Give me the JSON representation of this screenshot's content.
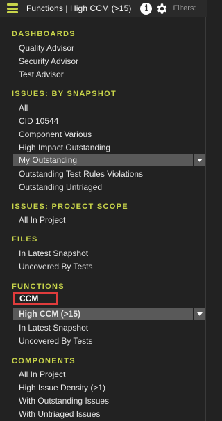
{
  "topbar": {
    "title": "Functions | High CCM (>15)",
    "filters_label": "Filters:",
    "menu_icon": "hamburger-icon",
    "info_icon": "info-icon",
    "settings_icon": "gear-icon",
    "accent_color": "#c8d44a"
  },
  "sections": {
    "dashboards": {
      "title": "DASHBOARDS",
      "items": [
        "Quality Advisor",
        "Security Advisor",
        "Test Advisor"
      ]
    },
    "issues_snapshot": {
      "title": "ISSUES: BY SNAPSHOT",
      "items": [
        "All",
        "CID 10544",
        "Component Various",
        "High Impact Outstanding",
        "My Outstanding",
        "Outstanding Test Rules Violations",
        "Outstanding Untriaged"
      ]
    },
    "issues_project": {
      "title": "ISSUES: PROJECT SCOPE",
      "items": [
        "All In Project"
      ]
    },
    "files": {
      "title": "FILES",
      "items": [
        "In Latest Snapshot",
        "Uncovered By Tests"
      ]
    },
    "functions": {
      "title": "FUNCTIONS",
      "items": [
        "CCM",
        "High CCM (>15)",
        "In Latest Snapshot",
        "Uncovered By Tests"
      ]
    },
    "components": {
      "title": "COMPONENTS",
      "items": [
        "All In Project",
        "High Issue Density (>1)",
        "With Outstanding Issues",
        "With Untriaged Issues"
      ]
    }
  },
  "highlight_color": "#e03c3c"
}
